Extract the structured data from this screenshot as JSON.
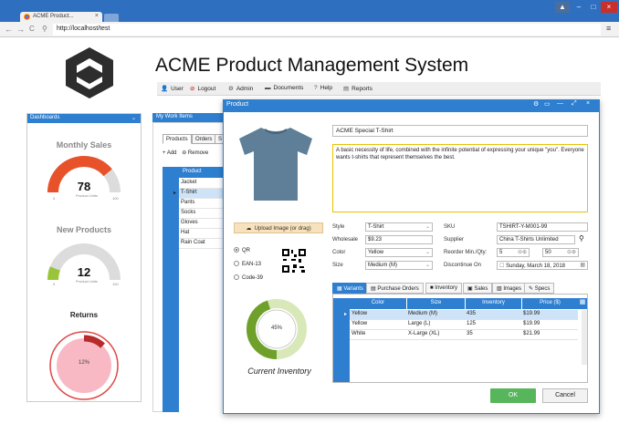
{
  "browser": {
    "tab_title": "ACME Product...",
    "url": "http://localhost/test"
  },
  "app": {
    "title": "ACME Product Management System"
  },
  "menu": [
    {
      "label": "User",
      "icon": "user-icon"
    },
    {
      "label": "Logout",
      "icon": "logout-icon"
    },
    {
      "label": "Admin",
      "icon": "gear-icon"
    },
    {
      "label": "Documents",
      "icon": "folder-icon"
    },
    {
      "label": "Help",
      "icon": "help-icon"
    },
    {
      "label": "Reports",
      "icon": "report-icon"
    }
  ],
  "dashboard": {
    "header": "Dashboards",
    "monthly_sales": {
      "title": "Monthly Sales",
      "value": "78",
      "sub": "Product Units",
      "min": "0",
      "max": "100",
      "fraction": 0.78,
      "color": "#e8522a"
    },
    "new_products": {
      "title": "New Products",
      "value": "12",
      "sub": "Product Units",
      "min": "0",
      "max": "100",
      "fraction": 0.12,
      "color": "#9ac53b"
    },
    "returns": {
      "title": "Returns",
      "value": "12%",
      "fraction": 0.12
    }
  },
  "work_items": {
    "header": "My Work Items",
    "tabs": [
      "Products",
      "Orders",
      "S"
    ],
    "add_label": "Add",
    "remove_label": "Remove",
    "column": "Product",
    "products": [
      "Jacket",
      "T-Shirt",
      "Pants",
      "Socks",
      "Gloves",
      "Hat",
      "Rain Coat"
    ],
    "selected": "T-Shirt"
  },
  "dialog": {
    "title": "Product",
    "upload_label": "Upload Image (or drag)",
    "barcodes": [
      {
        "label": "QR",
        "selected": true
      },
      {
        "label": "EAN-13",
        "selected": false
      },
      {
        "label": "Code-39",
        "selected": false
      }
    ],
    "inventory_pct": "45%",
    "inventory_fraction": 0.45,
    "inventory_label": "Current Inventory",
    "name": "ACME Special T-Shirt",
    "description": "A basic necessity of life, combined with the infinite potential of expressing your unique \"you\". Everyone wants t-shirts that represent themselves the best.",
    "fields": {
      "style_label": "Style",
      "style": "T-Shirt",
      "wholesale_label": "Wholesale",
      "wholesale": "$9.23",
      "color_label": "Color",
      "color": "Yellow",
      "size_label": "Size",
      "size": "Medium (M)",
      "sku_label": "SKU",
      "sku": "TSHIRT-Y-M001-99",
      "supplier_label": "Supplier",
      "supplier": "China T-Shirts Unlimited",
      "reorder_label": "Reorder Min./Qty:",
      "reorder_min": "5",
      "reorder_qty": "50",
      "discontinue_label": "Discontinue On",
      "discontinue": "Sunday, March 18, 2018"
    },
    "tabs": [
      "Variants",
      "Purchase Orders",
      "Inventory",
      "Sales",
      "Images",
      "Specs"
    ],
    "variant_columns": [
      "Color",
      "Size",
      "Inventory",
      "Price ($)"
    ],
    "variants": [
      {
        "color": "Yellow",
        "size": "Medium (M)",
        "inventory": "435",
        "price": "$19.99"
      },
      {
        "color": "Yellow",
        "size": "Large (L)",
        "inventory": "125",
        "price": "$19.99"
      },
      {
        "color": "White",
        "size": "X-Large (XL)",
        "inventory": "35",
        "price": "$21.99"
      }
    ],
    "ok_label": "OK",
    "cancel_label": "Cancel"
  }
}
